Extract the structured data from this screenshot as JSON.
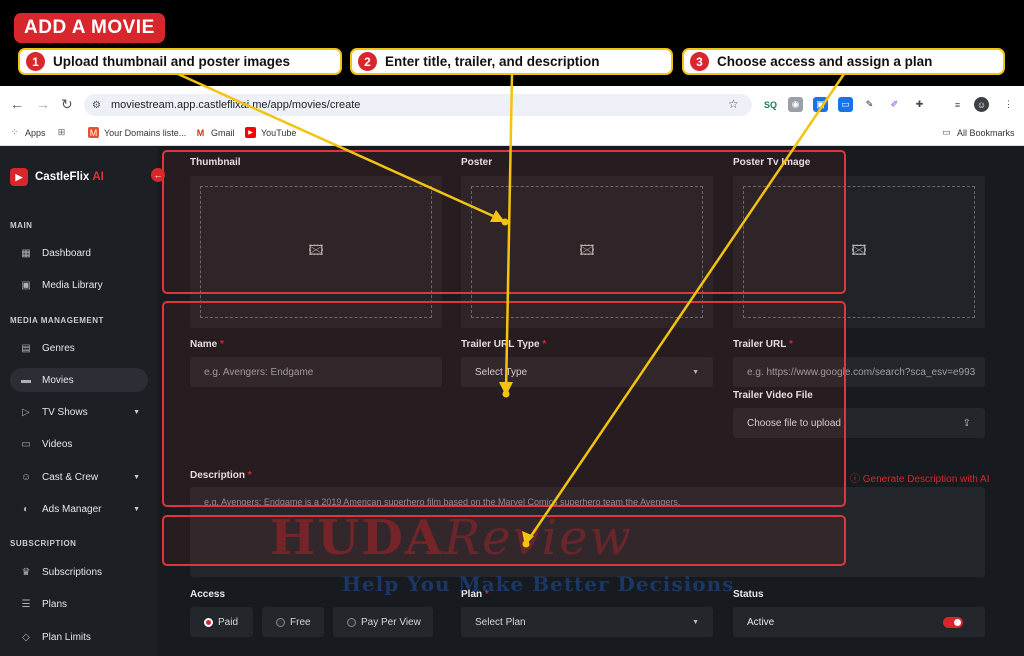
{
  "tutorial": {
    "title": "ADD A MOVIE",
    "steps": [
      {
        "num": "1",
        "text": "Upload thumbnail and poster images"
      },
      {
        "num": "2",
        "text": "Enter title, trailer, and description"
      },
      {
        "num": "3",
        "text": "Choose access and assign a plan"
      }
    ]
  },
  "browser": {
    "url": "moviestream.app.castleflixai.me/app/movies/create",
    "bookmarks": [
      "Apps",
      "Your Domains liste...",
      "Gmail",
      "YouTube"
    ],
    "all_bookmarks": "All Bookmarks",
    "ext_labels": [
      "SQ"
    ]
  },
  "sidebar": {
    "brand": "CastleFlix",
    "brand_ai": "AI",
    "sections": {
      "main": "MAIN",
      "media": "MEDIA MANAGEMENT",
      "subscription": "SUBSCRIPTION"
    },
    "items": {
      "dashboard": "Dashboard",
      "media_library": "Media Library",
      "genres": "Genres",
      "movies": "Movies",
      "tv_shows": "TV Shows",
      "videos": "Videos",
      "cast_crew": "Cast & Crew",
      "ads_manager": "Ads Manager",
      "subscriptions": "Subscriptions",
      "plans": "Plans",
      "plan_limits": "Plan Limits"
    }
  },
  "form": {
    "thumbnail_label": "Thumbnail",
    "poster_label": "Poster",
    "poster_tv_label": "Poster Tv Image",
    "name_label": "Name",
    "name_placeholder": "e.g. Avengers: Endgame",
    "trailer_type_label": "Trailer URL Type",
    "trailer_type_value": "Select Type",
    "trailer_url_label": "Trailer URL",
    "trailer_url_placeholder": "e.g. https://www.google.com/search?sca_esv=e993",
    "trailer_file_label": "Trailer Video File",
    "trailer_file_placeholder": "Choose file to upload",
    "description_label": "Description",
    "generate_ai": "Generate Description with AI",
    "description_placeholder": "e.g. Avengers: Endgame is a 2019 American superhero film based on the Marvel Comics superhero team the Avengers.",
    "required_mark": "*",
    "access_label": "Access",
    "access_options": [
      "Paid",
      "Free",
      "Pay Per View"
    ],
    "plan_label": "Plan",
    "plan_value": "Select Plan",
    "status_label": "Status",
    "status_value": "Active"
  },
  "watermark": {
    "brand": "HUDA",
    "brand2": "Review",
    "tagline": "Help You Make Better Decisions"
  },
  "colors": {
    "accent": "#d7262c",
    "highlight": "#f2c30f",
    "bg": "#171a1e"
  }
}
